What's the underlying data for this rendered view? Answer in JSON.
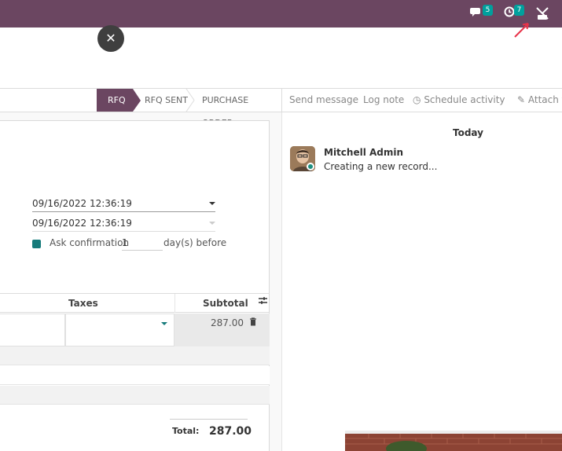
{
  "topbar": {
    "chat_badge": "5",
    "activity_badge": "7",
    "icons": [
      "chat-icon",
      "clock-icon",
      "debug-icon"
    ]
  },
  "status": {
    "stages": [
      "RFQ",
      "RFQ SENT",
      "PURCHASE ORDER"
    ],
    "active": "RFQ"
  },
  "form": {
    "date1": "09/16/2022 12:36:19",
    "date2": "09/16/2022 12:36:19",
    "ask_confirmation_label": "Ask confirmation",
    "ask_days": "1",
    "days_suffix": "day(s) before"
  },
  "table": {
    "headers": {
      "taxes": "Taxes",
      "subtotal": "Subtotal"
    },
    "row_subtotal": "287.00"
  },
  "totals": {
    "label": "Total:",
    "value": "287.00"
  },
  "chatter": {
    "send_message": "Send message",
    "log_note": "Log note",
    "schedule_activity": "Schedule activity",
    "attach": "Attach fi",
    "date_group": "Today",
    "author": "Mitchell Admin",
    "message": "Creating a new record..."
  },
  "colors": {
    "brand": "#6b4661",
    "accent": "#00a09d"
  }
}
